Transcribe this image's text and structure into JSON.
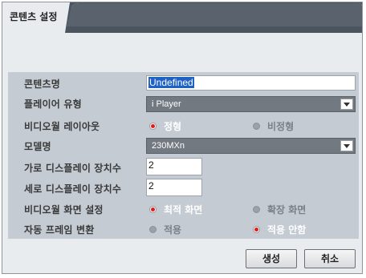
{
  "dialog": {
    "title": "콘텐츠 설정"
  },
  "form": {
    "content_name_label": "콘텐츠명",
    "content_name_value": "Undefined",
    "player_type_label": "플레이어 유형",
    "player_type_value": "i Player",
    "video_layout_label": "비디오월 레이아웃",
    "layout_regular": "정형",
    "layout_irregular": "비정형",
    "model_label": "모델명",
    "model_value": "230MXn",
    "horizontal_label": "가로 디스플레이 장치수",
    "horizontal_value": "2",
    "vertical_label": "세로 디스플레이 장치수",
    "vertical_value": "2",
    "screen_setting_label": "비디오월 화면 설정",
    "screen_optimal": "최적 화면",
    "screen_extended": "확장 화면",
    "auto_frame_label": "자동 프레임 변환",
    "auto_apply": "적용",
    "auto_not_apply": "적용 안함"
  },
  "buttons": {
    "create": "생성",
    "cancel": "취소"
  },
  "colors": {
    "title_bar": "#4b5560",
    "form_panel": "#c4cbd3",
    "radio_selected": "#e21b1b",
    "text_selection": "#1e63c4"
  }
}
